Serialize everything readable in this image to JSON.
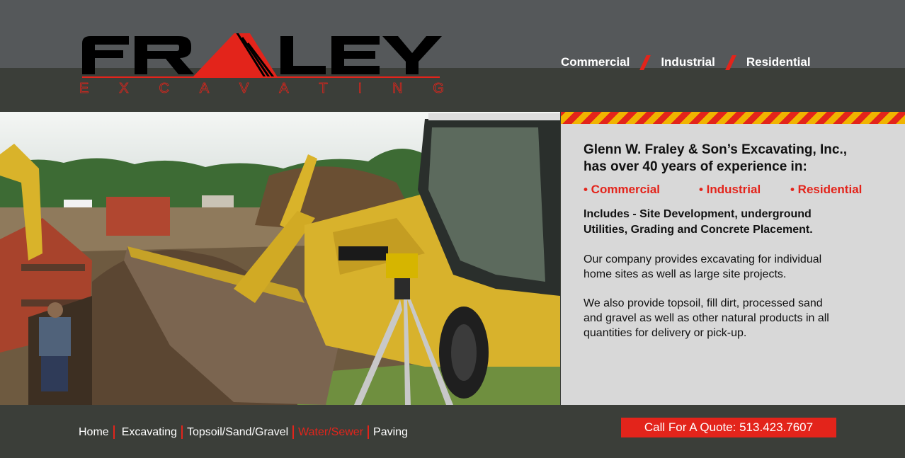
{
  "brand": {
    "logo_word": "FRALEY",
    "logo_tagline": "EXCAVATING",
    "colors": {
      "red": "#e3241b",
      "dark": "#3b3e39",
      "grey": "#55585a",
      "panel": "#d8d8d8",
      "hazard_yellow": "#f0b400"
    }
  },
  "top_nav": {
    "items": [
      "Commercial",
      "Industrial",
      "Residential"
    ]
  },
  "info": {
    "headline_line1": "Glenn W. Fraley & Son’s Excavating, Inc.,",
    "headline_line2": "has over 40 years of experience in:",
    "services": [
      "• Commercial",
      "• Industrial",
      "• Residential"
    ],
    "includes_line1": "Includes - Site Development, underground",
    "includes_line2": "Utilities, Grading and Concrete Placement.",
    "para1_line1": "Our company provides excavating for individual",
    "para1_line2": "home sites as well as large site projects.",
    "para2_line1": "We also provide topsoil, fill dirt, processed sand",
    "para2_line2": "and gravel as well as other natural products in all",
    "para2_line3": "quantities for delivery or pick-up."
  },
  "footer_nav": {
    "items": [
      "Home",
      "Excavating",
      "Topsoil/Sand/Gravel",
      "Water/Sewer",
      "Paving"
    ],
    "active": "Water/Sewer"
  },
  "quote_button": "Call For A Quote: 513.423.7607",
  "photo": {
    "subject": "backhoe-excavation-photo"
  }
}
